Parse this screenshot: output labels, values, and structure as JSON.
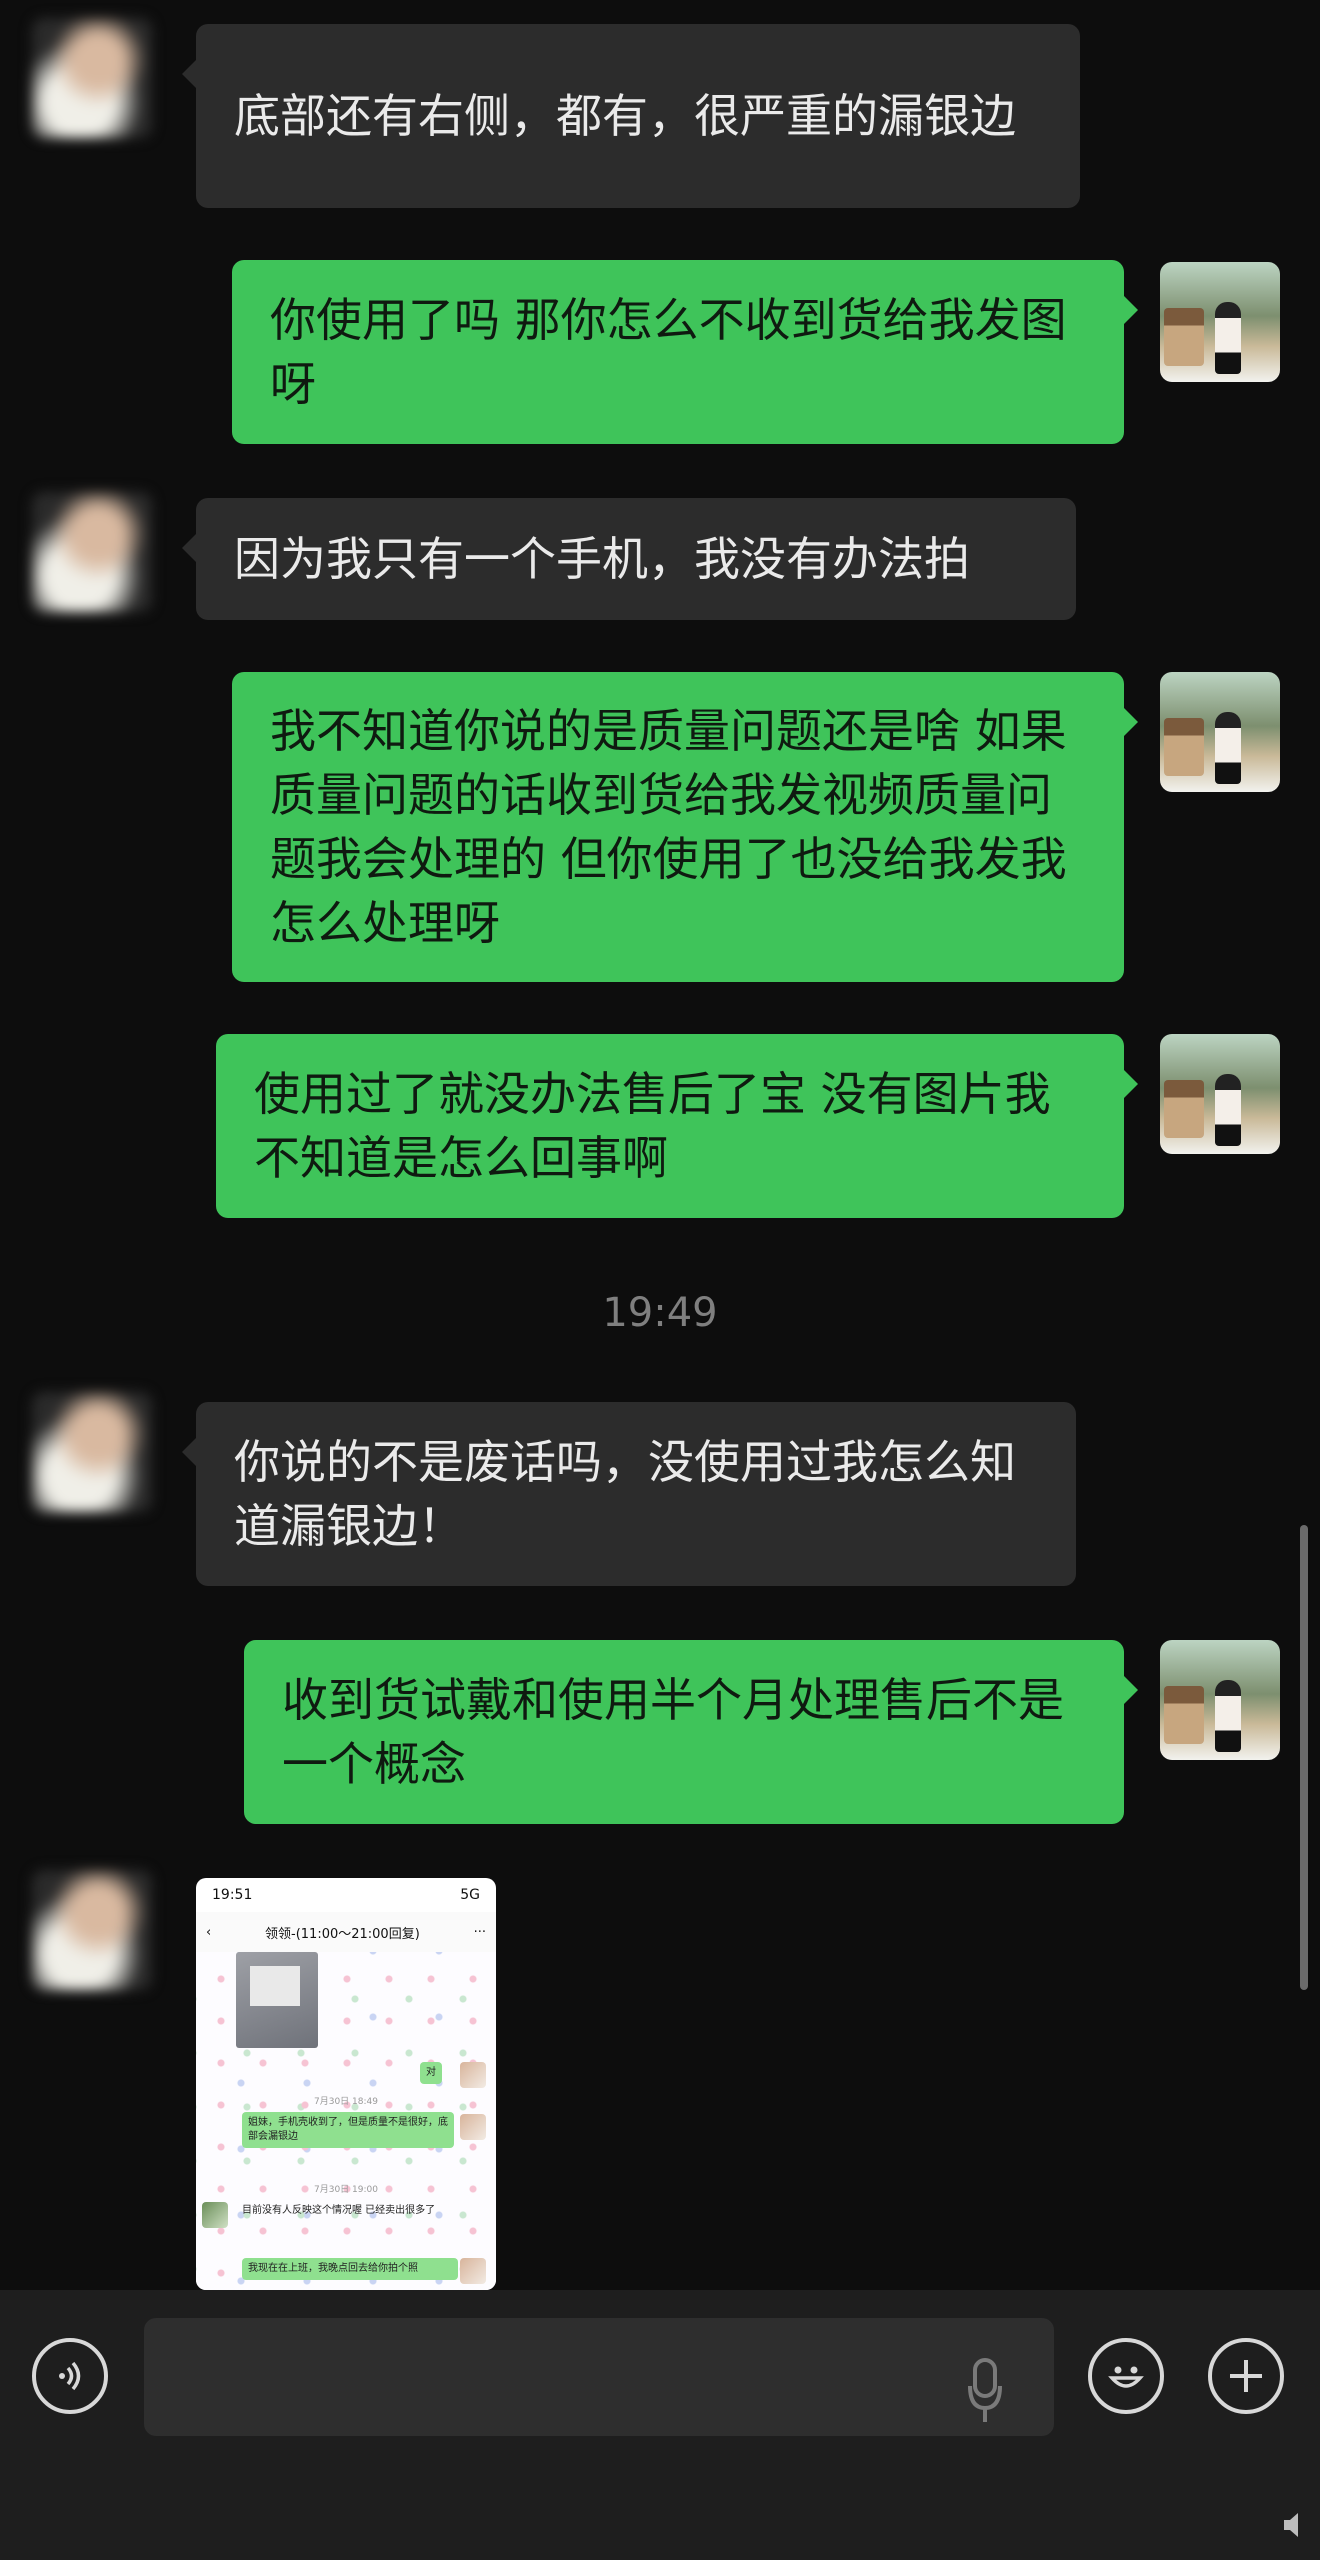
{
  "messages": [
    {
      "text": "底部还有右侧，都有，很严重的漏银边"
    },
    {
      "text": "你使用了吗 那你怎么不收到货给我发图呀"
    },
    {
      "text": "因为我只有一个手机，我没有办法拍"
    },
    {
      "text": "我不知道你说的是质量问题还是啥 如果质量问题的话收到货给我发视频质量问题我会处理的 但你使用了也没给我发我怎么处理呀"
    },
    {
      "text": "使用过了就没办法售后了宝  没有图片我不知道是怎么回事啊"
    },
    {
      "text": "你说的不是废话吗，没使用过我怎么知道漏银边！"
    },
    {
      "text": "收到货试戴和使用半个月处理售后不是一个概念"
    }
  ],
  "timestamp": "19:49",
  "shared_image": {
    "status_time": "19:51",
    "status_icons": "5G",
    "nav_title": "领领-(11:00～21:00回复)",
    "messages": [
      {
        "text": "对"
      },
      {
        "time": "7月30日 18:49"
      },
      {
        "text": "姐妹，手机壳收到了，但是质量不是很好，底部会漏银边"
      },
      {
        "time": "7月30日 19:00"
      },
      {
        "text": "目前没有人反映这个情况喔 已经卖出很多了"
      },
      {
        "text": "我现在在上班，我晚点回去给你拍个照"
      }
    ]
  },
  "colors": {
    "outgoing": "#3fc45a",
    "incoming": "#2c2c2c",
    "background": "#0d0d0d"
  },
  "icons": [
    "voice-icon",
    "microphone-icon",
    "emoji-icon",
    "plus-icon"
  ]
}
